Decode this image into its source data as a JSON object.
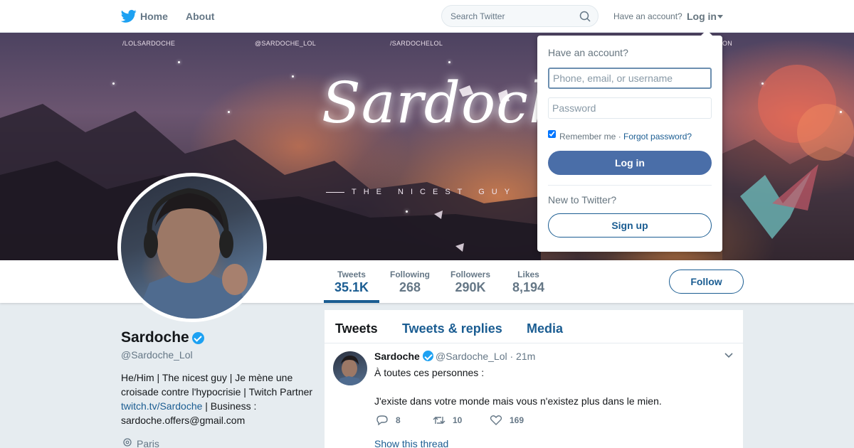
{
  "nav": {
    "home": "Home",
    "about": "About",
    "search_placeholder": "Search Twitter",
    "have_account": "Have an account?",
    "login": "Log in"
  },
  "banner": {
    "social_links": [
      "/LOLSARDOCHE",
      "@SARDOCHE_LOL",
      "/SARDOCHELOL",
      "ON"
    ],
    "title": "Sardoche",
    "subtitle": "THE NICEST GUY"
  },
  "stats": [
    {
      "label": "Tweets",
      "value": "35.1K"
    },
    {
      "label": "Following",
      "value": "268"
    },
    {
      "label": "Followers",
      "value": "290K"
    },
    {
      "label": "Likes",
      "value": "8,194"
    }
  ],
  "follow_label": "Follow",
  "profile": {
    "name": "Sardoche",
    "handle": "@Sardoche_Lol",
    "bio_pre": "He/Him | The nicest guy | Je mène une croisade contre l'hypocrisie | Twitch Partner ",
    "bio_link": "twitch.tv/Sardoche",
    "bio_post": " | Business : sardoche.offers@gmail.com",
    "location": "Paris"
  },
  "timeline": {
    "tabs": [
      "Tweets",
      "Tweets & replies",
      "Media"
    ],
    "tweet": {
      "name": "Sardoche",
      "handle_time": "@Sardoche_Lol · 21m",
      "text": "À toutes ces personnes :\n\nJ'existe dans votre monde mais vous n'existez plus dans le mien.",
      "replies": "8",
      "retweets": "10",
      "likes": "169",
      "show_thread": "Show this thread"
    }
  },
  "login_dropdown": {
    "title": "Have an account?",
    "username_placeholder": "Phone, email, or username",
    "password_placeholder": "Password",
    "remember": "Remember me ·",
    "forgot": "Forgot password?",
    "login_button": "Log in",
    "new_to": "New to Twitter?",
    "signup_button": "Sign up"
  },
  "colors": {
    "accent": "#1b5d92",
    "login_button": "#4a6ea8",
    "verified": "#1da1f2"
  }
}
